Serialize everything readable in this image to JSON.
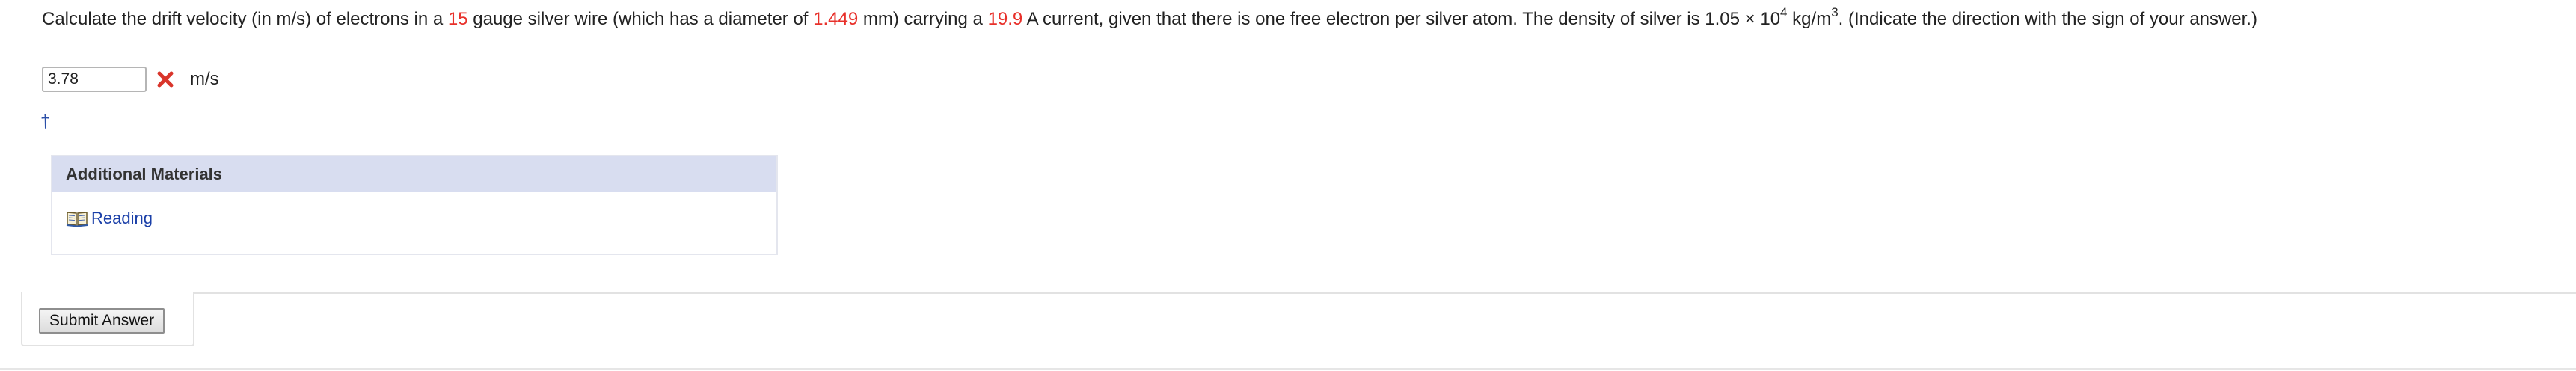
{
  "question": {
    "part1": "Calculate the drift velocity (in m/s) of electrons in a ",
    "gauge": "15",
    "part2": " gauge silver wire (which has a diameter of ",
    "diameter": "1.449",
    "part3": " mm) carrying a ",
    "current": "19.9",
    "part4": " A current, given that there is one free electron per silver atom. The density of silver is 1.05 × 10",
    "density_exponent": "4",
    "part5": " kg/m",
    "unit_exponent": "3",
    "part6": ". (Indicate the direction with the sign of your answer.)"
  },
  "answer": {
    "value": "3.78",
    "status_icon": "x-mark-icon",
    "unit": "m/s"
  },
  "dagger": "†",
  "additional_materials": {
    "header": "Additional Materials",
    "link_icon": "book-icon",
    "link_label": "Reading"
  },
  "submit": {
    "label": "Submit Answer"
  },
  "colors": {
    "highlight_red": "#e8302a",
    "link_blue": "#1a3fa8",
    "materials_header_bg": "#d8ddf0"
  }
}
